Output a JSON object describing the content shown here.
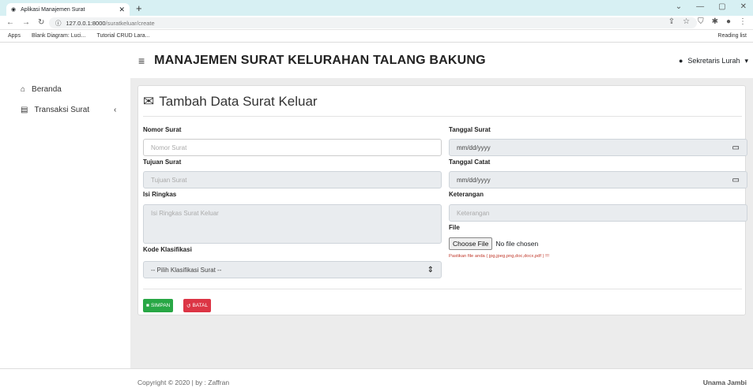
{
  "browser": {
    "tab_title": "Aplikasi Manajemen Surat",
    "url_host": "127.0.0.1:8000",
    "url_path": "/suratkeluar/create",
    "bookmarks": [
      "Apps",
      "Blank Diagram: Luci...",
      "Tutorial CRUD Lara..."
    ],
    "reading_list": "Reading list"
  },
  "header": {
    "title": "MANAJEMEN SURAT KELURAHAN TALANG BAKUNG",
    "user": "Sekretaris Lurah"
  },
  "sidebar": {
    "items": [
      {
        "label": "Beranda",
        "icon": "home-icon"
      },
      {
        "label": "Transaksi Surat",
        "icon": "money-icon"
      }
    ]
  },
  "form": {
    "title": "Tambah Data Surat Keluar",
    "nomor_label": "Nomor Surat",
    "nomor_placeholder": "Nomor Surat",
    "tujuan_label": "Tujuan Surat",
    "tujuan_placeholder": "Tujuan Surat",
    "isi_label": "Isi Ringkas",
    "isi_placeholder": "Isi Ringkas Surat Keluar",
    "kode_label": "Kode Klasifikasi",
    "kode_selected": "-- Pilih Klasifikasi Surat --",
    "tanggal_surat_label": "Tanggal Surat",
    "tanggal_surat_value": "mm/dd/yyyy",
    "tanggal_catat_label": "Tanggal Catat",
    "tanggal_catat_value": "mm/dd/yyyy",
    "keterangan_label": "Keterangan",
    "keterangan_placeholder": "Keterangan",
    "file_label": "File",
    "file_button": "Choose File",
    "file_status": "No file chosen",
    "file_hint": "Pastikan file anda ( jpg,jpeg,png,doc,docx,pdf ) !!!",
    "save_label": "SIMPAN",
    "cancel_label": "BATAL",
    "save_color": "#28a745",
    "cancel_color": "#dc3545"
  },
  "footer": {
    "copyright": "Copyright © 2020 | by : Zaffran",
    "org": "Unama Jambi"
  }
}
